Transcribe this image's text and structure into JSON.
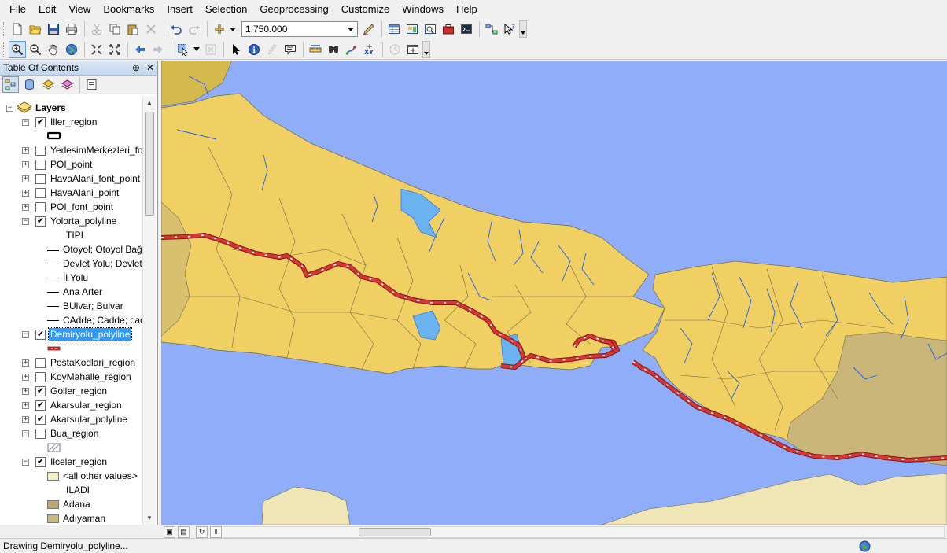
{
  "menu": [
    "File",
    "Edit",
    "View",
    "Bookmarks",
    "Insert",
    "Selection",
    "Geoprocessing",
    "Customize",
    "Windows",
    "Help"
  ],
  "toolbar": {
    "scale": "1:750.000",
    "buttons_row1": [
      "new-document-icon",
      "open-folder-icon",
      "save-icon",
      "print-icon",
      "cut-icon",
      "copy-icon",
      "paste-icon",
      "delete-icon",
      "undo-icon",
      "redo-icon",
      "add-data-icon"
    ],
    "buttons_row1b": [
      "editor-icon",
      "table-icon",
      "catalog-icon",
      "search-window-icon",
      "arctoolbox-icon",
      "python-icon",
      "model-builder-icon",
      "whats-this-icon"
    ],
    "buttons_row2": [
      "zoom-in-icon",
      "zoom-out-icon",
      "pan-hand-icon",
      "full-extent-globe-icon",
      "fixed-zoom-in-icon",
      "fixed-zoom-out-icon",
      "back-extent-icon",
      "forward-extent-icon",
      "select-features-icon",
      "clear-selection-icon",
      "select-elements-icon",
      "identify-icon",
      "hyperlink-icon",
      "html-popup-icon",
      "measure-icon",
      "find-icon",
      "find-route-icon",
      "go-to-xy-icon",
      "time-slider-icon",
      "viewer-window-icon"
    ]
  },
  "toc": {
    "title": "Table Of Contents",
    "pin": "⊕",
    "close": "✕",
    "tools": [
      "list-by-drawing-order-icon",
      "list-by-source-icon",
      "list-by-visibility-icon",
      "list-by-selection-icon",
      "options-icon"
    ],
    "root_label": "Layers",
    "rows": [
      {
        "kind": "layer",
        "exp": "−",
        "checked": true,
        "label": "Iller_region"
      },
      {
        "kind": "symbol",
        "symbol": "iller"
      },
      {
        "kind": "layer",
        "exp": "+",
        "checked": false,
        "label": "YerlesimMerkezleri_fo"
      },
      {
        "kind": "layer",
        "exp": "+",
        "checked": false,
        "label": "POI_point"
      },
      {
        "kind": "layer",
        "exp": "+",
        "checked": false,
        "label": "HavaAlani_font_point"
      },
      {
        "kind": "layer",
        "exp": "+",
        "checked": false,
        "label": "HavaAlani_point"
      },
      {
        "kind": "layer",
        "exp": "+",
        "checked": false,
        "label": "POI_font_point"
      },
      {
        "kind": "layer",
        "exp": "−",
        "checked": true,
        "label": "Yolorta_polyline"
      },
      {
        "kind": "heading",
        "label": "TIPI"
      },
      {
        "kind": "legend",
        "symbol": "double-line",
        "label": "Otoyol; Otoyol Bağ"
      },
      {
        "kind": "legend",
        "symbol": "line",
        "label": "Devlet Yolu; Devlet"
      },
      {
        "kind": "legend",
        "symbol": "line",
        "label": "İl Yolu"
      },
      {
        "kind": "legend",
        "symbol": "line",
        "label": "Ana Arter"
      },
      {
        "kind": "legend",
        "symbol": "line",
        "label": "BUlvar; Bulvar"
      },
      {
        "kind": "legend",
        "symbol": "line",
        "label": "CAdde; Cadde; cad"
      },
      {
        "kind": "layer",
        "exp": "−",
        "checked": true,
        "label": "Demiryolu_polyline",
        "selected": true
      },
      {
        "kind": "symbol",
        "symbol": "rail"
      },
      {
        "kind": "layer",
        "exp": "+",
        "checked": false,
        "label": "PostaKodlari_region"
      },
      {
        "kind": "layer",
        "exp": "+",
        "checked": false,
        "label": "KoyMahalle_region"
      },
      {
        "kind": "layer",
        "exp": "+",
        "checked": true,
        "label": "Goller_region"
      },
      {
        "kind": "layer",
        "exp": "+",
        "checked": true,
        "label": "Akarsular_region"
      },
      {
        "kind": "layer",
        "exp": "+",
        "checked": true,
        "label": "Akarsular_polyline"
      },
      {
        "kind": "layer",
        "exp": "−",
        "checked": false,
        "label": "Bua_region"
      },
      {
        "kind": "symbol",
        "symbol": "hatch"
      },
      {
        "kind": "layer",
        "exp": "−",
        "checked": true,
        "label": "Ilceler_region"
      },
      {
        "kind": "legend",
        "symbol": "fill",
        "color": "#f2f1c0",
        "label": "<all other values>"
      },
      {
        "kind": "heading",
        "label": "ILADI"
      },
      {
        "kind": "legend",
        "symbol": "fill",
        "color": "#c2a56c",
        "label": "Adana"
      },
      {
        "kind": "legend",
        "symbol": "fill",
        "color": "#cbb97d",
        "label": "Adıyaman"
      }
    ]
  },
  "map": {
    "water_color": "#8fadf9",
    "land_color": "#f0d062",
    "land_dim_color": "#d8c06e",
    "land_tan_color": "#cbb67a",
    "land_pale_color": "#efe5b5",
    "border_color": "#6f6a4a",
    "stream_color": "#1f5cf5",
    "lake_color": "#6bb3f0",
    "rail_color": "#d93535"
  },
  "mapbar": {
    "buttons": [
      "layout-view-icon",
      "data-view-icon",
      "refresh-icon",
      "pause-drawing-icon"
    ]
  },
  "status": {
    "text": "Drawing Demiryolu_polyline..."
  }
}
